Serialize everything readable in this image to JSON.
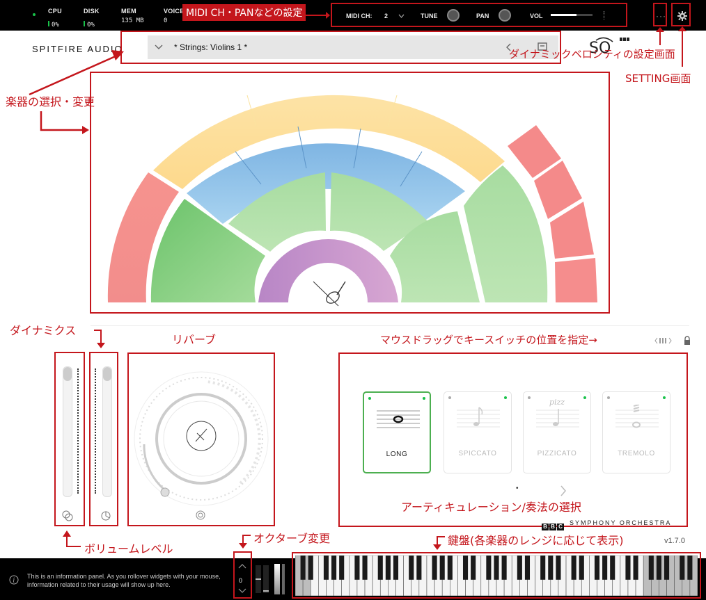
{
  "topbar": {
    "stats": [
      {
        "label": "CPU",
        "value": "0%"
      },
      {
        "label": "DISK",
        "value": "0%"
      },
      {
        "label": "MEM",
        "value": "135 MB"
      },
      {
        "label": "VOICES",
        "value": "0"
      }
    ],
    "midi_ch_label": "MIDI CH:",
    "midi_ch_value": "2",
    "tune_label": "TUNE",
    "pan_label": "PAN",
    "vol_label": "VOL",
    "vol_level": 0.62,
    "more_glyph": "···",
    "settings_icon": "gear-icon"
  },
  "header": {
    "brand": "SPITFIRE AUDIO",
    "preset": "* Strings: Violins 1 *"
  },
  "articulations": {
    "cards": [
      {
        "name": "LONG",
        "active": true
      },
      {
        "name": "SPICCATO",
        "active": false
      },
      {
        "name": "PIZZICATO",
        "active": false,
        "marking": "pizz"
      },
      {
        "name": "TREMOLO",
        "active": false
      }
    ],
    "page_dot": "•",
    "footer": "SYMPHONY ORCHESTRA",
    "bbc": [
      "B",
      "B",
      "C"
    ]
  },
  "version": "v1.7.0",
  "octave": "0",
  "info_panel": "This is an information panel. As you rollover widgets with your mouse, information related to their usage will show up here.",
  "annotations": {
    "midi": "MIDI CH・PANなどの設定",
    "dyn_velocity": "ダイナミックベロシティの設定画面",
    "setting": "SETTING画面",
    "instrument": "楽器の選択・変更",
    "dynamics": "ダイナミクス",
    "reverb": "リバーブ",
    "keyswitch": "マウスドラッグでキースイッチの位置を指定→",
    "articulation": "アーティキュレーション/奏法の選択",
    "volume_level": "ボリュームレベル",
    "octave": "オクターブ変更",
    "keyboard": "鍵盤(各楽器のレンジに応じて表示)"
  },
  "colors": {
    "accent_red": "#c4161c",
    "active_green": "#4caf50"
  }
}
